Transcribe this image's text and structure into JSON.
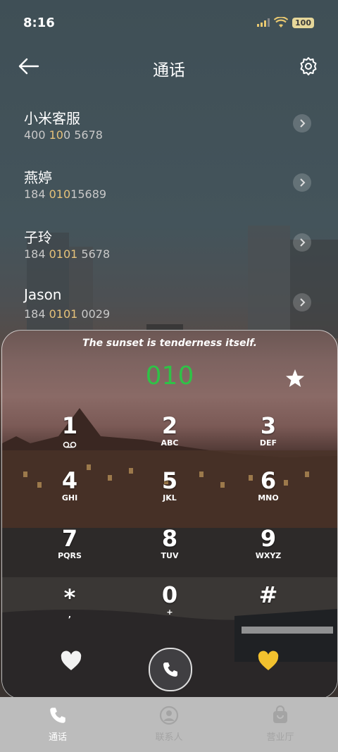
{
  "status": {
    "time": "8:16",
    "battery": "100"
  },
  "header": {
    "title": "通话"
  },
  "contacts": [
    {
      "name": "小米客服",
      "number_pre": "400 ",
      "number_hl": "10",
      "number_post": "0 5678"
    },
    {
      "name": "燕婷",
      "number_pre": "184 ",
      "number_hl": "010",
      "number_post": "15689"
    },
    {
      "name": "子玲",
      "number_pre": "184 ",
      "number_hl": "0101",
      "number_post": " 5678"
    },
    {
      "name": "Jason",
      "number_pre": "184 ",
      "number_hl": "0101",
      "number_post": " 0029"
    }
  ],
  "dialer": {
    "quote": "The sunset is tenderness itself.",
    "entered": "010",
    "keys": [
      {
        "digit": "1",
        "letters": "voicemail"
      },
      {
        "digit": "2",
        "letters": "ABC"
      },
      {
        "digit": "3",
        "letters": "DEF"
      },
      {
        "digit": "4",
        "letters": "GHI"
      },
      {
        "digit": "5",
        "letters": "JKL"
      },
      {
        "digit": "6",
        "letters": "MNO"
      },
      {
        "digit": "7",
        "letters": "PQRS"
      },
      {
        "digit": "8",
        "letters": "TUV"
      },
      {
        "digit": "9",
        "letters": "WXYZ"
      },
      {
        "digit": "*",
        "letters": ","
      },
      {
        "digit": "0",
        "letters": "+"
      },
      {
        "digit": "#",
        "letters": ""
      }
    ]
  },
  "tabs": [
    {
      "label": "通话",
      "icon": "phone-icon",
      "active": true
    },
    {
      "label": "联系人",
      "icon": "person-icon",
      "active": false
    },
    {
      "label": "营业厅",
      "icon": "bag-icon",
      "active": false
    }
  ],
  "colors": {
    "accent_green": "#2fc247",
    "highlight": "#e6c27a",
    "yellow_heart": "#f2c12e"
  }
}
